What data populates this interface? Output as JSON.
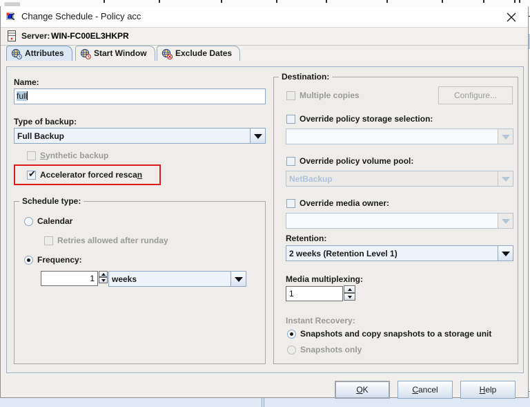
{
  "window": {
    "title": "Change Schedule - Policy acc",
    "close_label": "×",
    "app_icon": "application-icon"
  },
  "server_bar": {
    "icon": "server-icon",
    "label": "Server:",
    "value": "WIN-FC00EL3HKPR"
  },
  "tabs": [
    {
      "label": "Attributes",
      "icon": "clock-globe-icon",
      "active": true
    },
    {
      "label": "Start Window",
      "icon": "clock-start-icon",
      "active": false
    },
    {
      "label": "Exclude Dates",
      "icon": "clock-exclude-icon",
      "active": false
    }
  ],
  "left": {
    "name_label": "Name:",
    "name_value": "full",
    "type_label": "Type of backup:",
    "type_value": "Full Backup",
    "synthetic_label": "Synthetic backup",
    "synthetic_mnemonic": "S",
    "accelerator_label": "Accelerator forced rescan",
    "accelerator_mnemonic": "n",
    "schedule_group": "Schedule type:",
    "calendar_label": "Calendar",
    "retries_label": "Retries allowed after runday",
    "frequency_label": "Frequency:",
    "frequency_value": "1",
    "frequency_unit": "weeks"
  },
  "right": {
    "destination_group": "Destination:",
    "multiple_copies_label": "Multiple copies",
    "configure_label": "Configure...",
    "configure_mnemonic": "g",
    "override_storage_label": "Override policy storage selection:",
    "override_storage_value": "",
    "override_volume_label": "Override policy volume pool:",
    "override_volume_value": "NetBackup",
    "override_media_label": "Override media owner:",
    "override_media_value": "",
    "retention_label": "Retention:",
    "retention_value": "2 weeks (Retention Level 1)",
    "multiplexing_label": "Media multiplexing:",
    "multiplexing_value": "1",
    "instant_recovery_label": "Instant Recovery:",
    "snapshots_copy_label": "Snapshots and copy snapshots to a storage unit",
    "snapshots_only_label": "Snapshots only"
  },
  "buttons": {
    "ok": "OK",
    "ok_mnemonic": "O",
    "cancel": "Cancel",
    "cancel_mnemonic": "C",
    "help": "Help",
    "help_mnemonic": "H"
  },
  "annotation": {
    "highlight_color": "#e01b1b",
    "target": "Accelerator forced rescan"
  }
}
